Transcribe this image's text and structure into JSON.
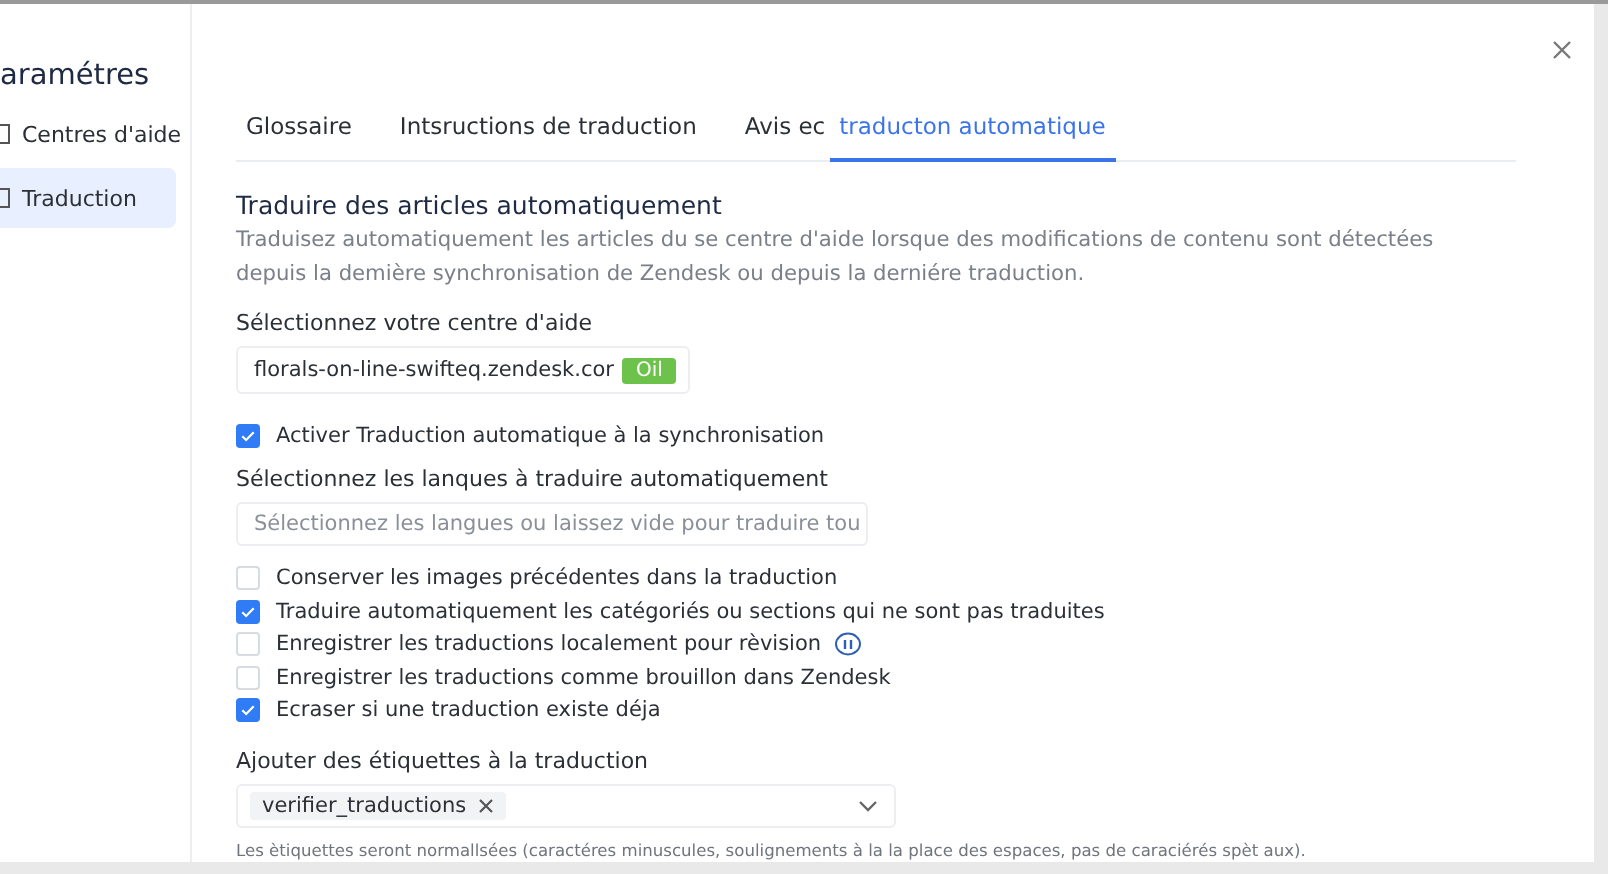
{
  "sidebar": {
    "title": "aramétres",
    "items": [
      {
        "label": "Centres d'aide",
        "selected": false
      },
      {
        "label": "Traduction",
        "selected": true
      }
    ]
  },
  "tabs": [
    {
      "label": "Glossaire",
      "selected": false
    },
    {
      "label": "Intsructions de traduction",
      "selected": false
    },
    {
      "label": "Avis ec",
      "selected": false
    },
    {
      "label": "traducton automatique",
      "selected": true
    }
  ],
  "section": {
    "title": "Traduire des articles automatiquement",
    "description": "Traduisez automatiquement les articles du se centre d'aide lorsque des modifications de contenu sont détectées depuis la demière synchronisation de Zendesk ou depuis la derniére traduction."
  },
  "help_center": {
    "label": "Sélectionnez votre centre d'aide",
    "value": "florals-on-line-swifteq.zendesk.cor",
    "badge": "Oil"
  },
  "sync_option": {
    "label": "Activer Traduction automatique à la synchronisation",
    "checked": true
  },
  "languages": {
    "label": "Sélectionnez les lanques à traduire automatiquement",
    "placeholder": "Sélectionnez les langues ou laissez vide pour traduire tou"
  },
  "options": [
    {
      "label": "Conserver les images précédentes dans la traduction",
      "checked": false,
      "info": false
    },
    {
      "label": "Traduire automatiquement les catégoriés ou sections qui ne sont pas traduites",
      "checked": true,
      "info": false
    },
    {
      "label": "Enregistrer les traductions localement pour rèvision",
      "checked": false,
      "info": true
    },
    {
      "label": "Enregistrer les traductions comme brouillon dans Zendesk",
      "checked": false,
      "info": false
    },
    {
      "label": "Ecraser si une traduction existe déja",
      "checked": true,
      "info": false
    }
  ],
  "tags": {
    "label": "Ajouter des étiquettes à la traduction",
    "values": [
      "verifier_traductions"
    ],
    "hint": "Les ètiquettes seront normallsées (caractéres minuscules, soulignements à la la place des espaces, pas de caraciérés spèt aux)."
  }
}
